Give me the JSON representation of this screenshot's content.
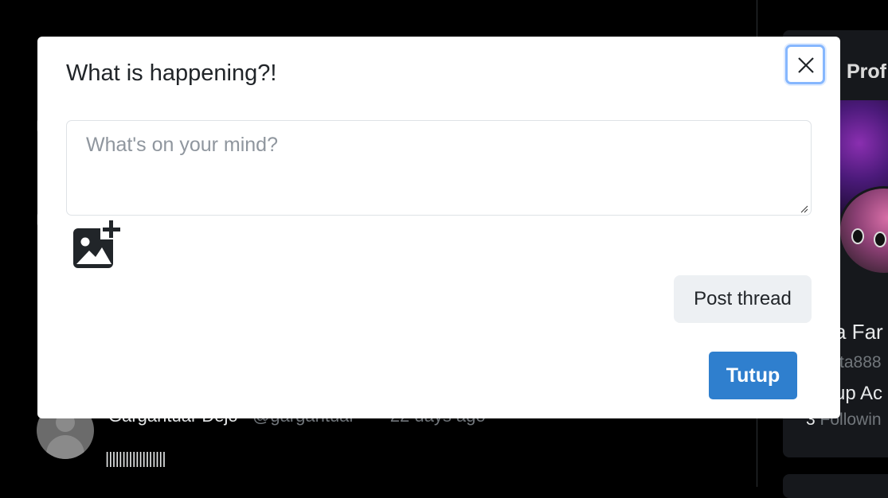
{
  "modal": {
    "title": "What is happening?!",
    "input": {
      "placeholder": "What's on your mind?",
      "value": ""
    },
    "post_label": "Post thread",
    "close_label": "Tutup",
    "accent": "#2f7fce"
  },
  "background": {
    "profile": {
      "title": "Prof",
      "name": "a Far",
      "handle": "ta888",
      "action": "up Ac",
      "following_count": "3",
      "following_label": "Followin"
    },
    "post": {
      "author": "Gargantuar Dejo",
      "handle": "@gargantuar",
      "separator": "·",
      "time": "22 days ago",
      "text": "||||||||||||||||||"
    }
  },
  "icons": {
    "close": "close-icon",
    "image_add": "image-add-icon",
    "avatar": "default-avatar-icon"
  }
}
